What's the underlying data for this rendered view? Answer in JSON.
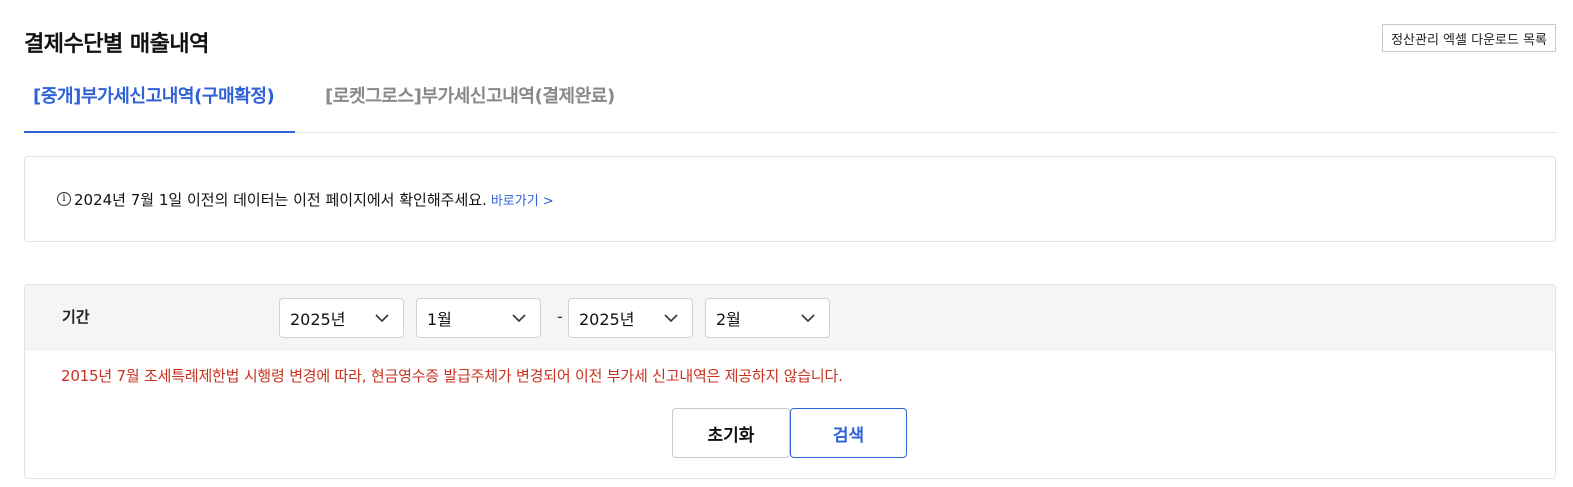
{
  "page": {
    "title": "결제수단별 매출내역",
    "excel_button": "정산관리 엑셀 다운로드 목록"
  },
  "tabs": [
    {
      "label": "[중개]부가세신고내역(구매확정)",
      "active": true
    },
    {
      "label": "[로켓그로스]부가세신고내역(결제완료)",
      "active": false
    }
  ],
  "notice": {
    "icon": "info-circle-icon",
    "text": "2024년 7월 1일 이전의 데이터는 이전 페이지에서 확인해주세요.",
    "link": "바로가기 >"
  },
  "filter": {
    "label": "기간",
    "start_year": "2025년",
    "start_month": "1월",
    "separator": "-",
    "end_year": "2025년",
    "end_month": "2월"
  },
  "warning": "2015년 7월 조세특례제한법 시행령 변경에 따라, 현금영수증 발급주체가 변경되어 이전 부가세 신고내역은 제공하지 않습니다.",
  "buttons": {
    "reset": "초기화",
    "search": "검색"
  },
  "colors": {
    "accent": "#2f62d6",
    "warning": "#c8321f",
    "filter_bg": "#f4f5f7"
  }
}
